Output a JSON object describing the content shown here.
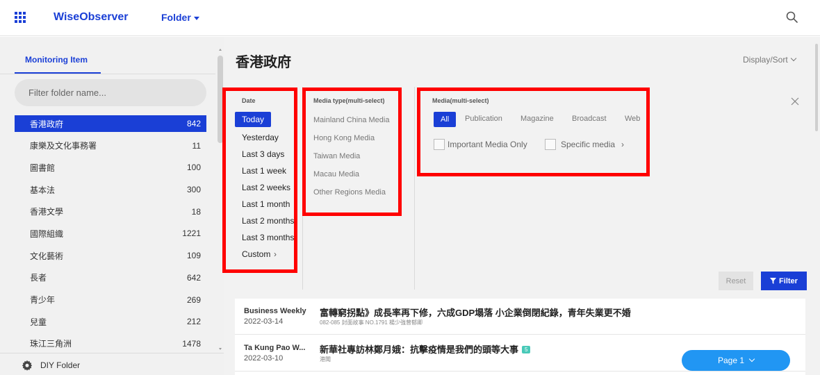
{
  "header": {
    "brand": "WiseObserver",
    "folder_menu": "Folder",
    "icons": {
      "apps": "apps-grid-icon",
      "search": "search-icon"
    },
    "accent_color": "#1a3fd6"
  },
  "sidebar": {
    "tab_label": "Monitoring Item",
    "filter_placeholder": "Filter folder name...",
    "items": [
      {
        "label": "香港政府",
        "count": "842",
        "selected": true
      },
      {
        "label": "康樂及文化事務署",
        "count": "11"
      },
      {
        "label": "圖書館",
        "count": "100"
      },
      {
        "label": "基本法",
        "count": "300"
      },
      {
        "label": "香港文學",
        "count": "18"
      },
      {
        "label": "國際組織",
        "count": "1221"
      },
      {
        "label": "文化藝術",
        "count": "109"
      },
      {
        "label": "長者",
        "count": "642"
      },
      {
        "label": "青少年",
        "count": "269"
      },
      {
        "label": "兒童",
        "count": "212"
      },
      {
        "label": "珠江三角洲",
        "count": "1478"
      }
    ],
    "diy_folder": "DIY Folder"
  },
  "main": {
    "title": "香港政府",
    "display_sort": "Display/Sort",
    "date": {
      "title": "Date",
      "options": [
        "Today",
        "Yesterday",
        "Last 3 days",
        "Last 1 week",
        "Last 2 weeks",
        "Last 1 month",
        "Last 2 months",
        "Last 3 months",
        "Custom"
      ],
      "selected": "Today"
    },
    "media_type": {
      "title": "Media type(multi-select)",
      "options": [
        "Mainland China Media",
        "Hong Kong Media",
        "Taiwan Media",
        "Macau Media",
        "Other Regions Media"
      ]
    },
    "media": {
      "title": "Media(multi-select)",
      "options": [
        "All",
        "Publication",
        "Magazine",
        "Broadcast",
        "Web"
      ],
      "selected": "All",
      "important_only": "Important Media Only",
      "specific_media": "Specific media"
    },
    "reset": "Reset",
    "filter": "Filter",
    "results": [
      {
        "source": "Business Weekly",
        "date": "2022-03-14",
        "headline": "富轉窮拐點》成長率再下修，六成GDP塌落 小企業倒閉紀錄，青年失業更不婚",
        "sub": "082-085 封面故事 NO.1791 楊少強曾郁卿"
      },
      {
        "source": "Ta Kung Pao W...",
        "date": "2022-03-10",
        "headline": "新華社專訪林鄭月娥：抗擊疫情是我們的頭等大事",
        "badge": "5",
        "sub": "港聞"
      }
    ],
    "page_button": "Page 1"
  }
}
